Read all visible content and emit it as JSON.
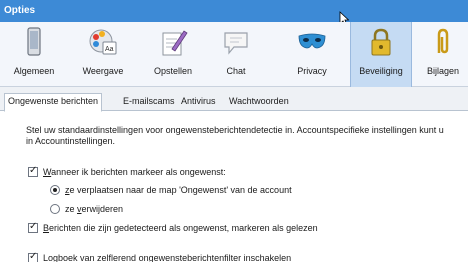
{
  "window": {
    "title": "Opties"
  },
  "toolbar": {
    "items": [
      {
        "label": "Algemeen",
        "icon": "phone-device-icon"
      },
      {
        "label": "Weergave",
        "icon": "palette-icon"
      },
      {
        "label": "Opstellen",
        "icon": "pencil-document-icon"
      },
      {
        "label": "Chat",
        "icon": "chat-bubble-icon"
      },
      {
        "label": "Privacy",
        "icon": "mask-icon"
      },
      {
        "label": "Beveiliging",
        "icon": "padlock-icon"
      },
      {
        "label": "Bijlagen",
        "icon": "paperclip-icon"
      }
    ],
    "active": "Beveiliging"
  },
  "tabs": [
    {
      "label": "Ongewenste berichten"
    },
    {
      "label": "E-mailscams"
    },
    {
      "label": "Antivirus"
    },
    {
      "label": "Wachtwoorden"
    }
  ],
  "content": {
    "description_line1": "Stel uw standaardinstellingen voor ongewensteberichtendetectie in. Accountspecifieke instellingen kunt u",
    "description_line2": "in Accountinstellingen.",
    "mark_as_junk": {
      "prefix": "",
      "accel": "W",
      "rest": "anneer ik berichten markeer als ongewenst:",
      "checked": true
    },
    "move_option": {
      "accel": "z",
      "rest": "e verplaatsen naar de map 'Ongewenst' van de account",
      "selected": true
    },
    "delete_option": {
      "prefix": "ze ",
      "accel": "v",
      "rest": "erwijderen",
      "selected": false
    },
    "mark_read": {
      "accel": "B",
      "rest": "erichten die zijn gedetecteerd als ongewenst, markeren als gelezen",
      "checked": true
    },
    "log_enable": {
      "text": "Logboek van zelflerend ongewensteberichtenfilter inschakelen",
      "checked": true
    }
  },
  "colors": {
    "titlebar": "#3d8ad6",
    "active_tool": "#c5dbf3"
  }
}
